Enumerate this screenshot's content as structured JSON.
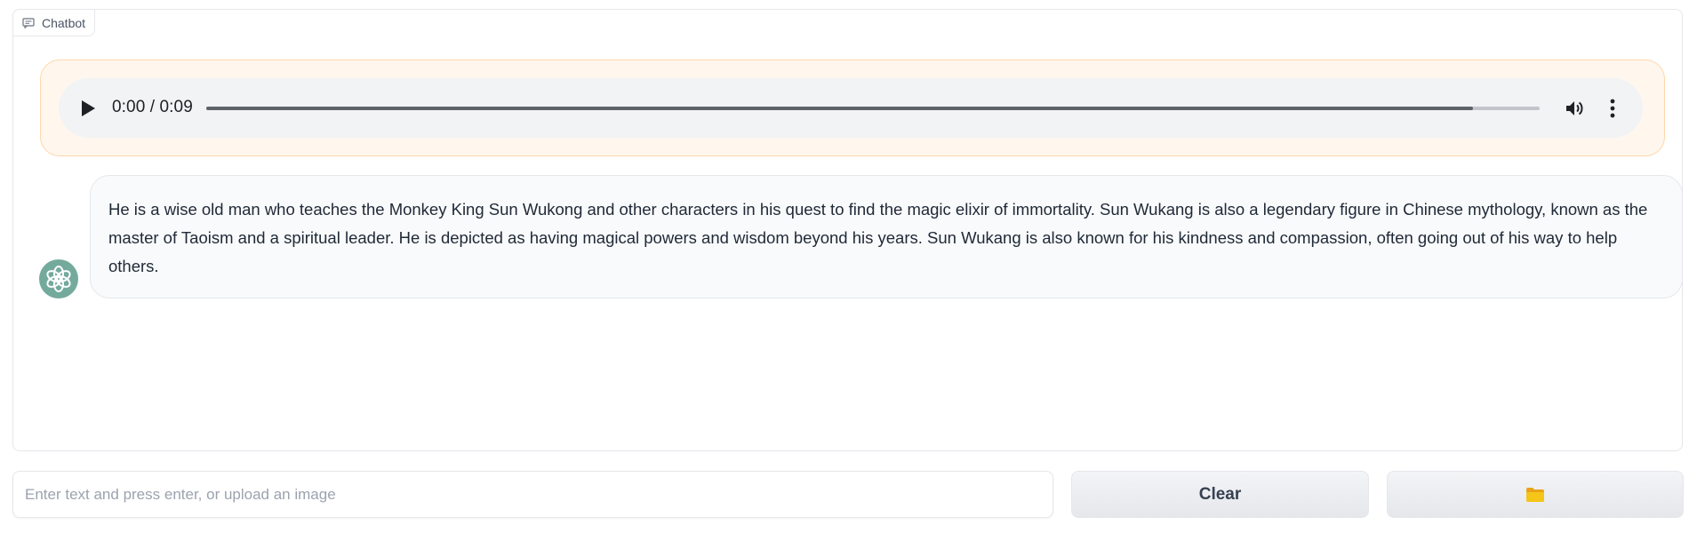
{
  "panel": {
    "label": "Chatbot"
  },
  "user_message": {
    "audio": {
      "time_display": "0:00 / 0:09",
      "progress": 0.95
    }
  },
  "bot_message": {
    "avatar_icon": "openai-logo-icon",
    "text": "He is a wise old man who teaches the Monkey King Sun Wukong and other characters in his quest to find the magic elixir of immortality. Sun Wukang is also a legendary figure in Chinese mythology, known as the master of Taoism and a spiritual leader. He is depicted as having magical powers and wisdom beyond his years. Sun Wukang is also known for his kindness and compassion, often going out of his way to help others."
  },
  "input": {
    "placeholder": "Enter text and press enter, or upload an image",
    "value": ""
  },
  "buttons": {
    "clear_label": "Clear",
    "upload_icon": "folder-icon"
  },
  "colors": {
    "user_bubble_bg": "#fff7ed",
    "user_bubble_border": "#fed7aa",
    "bot_bubble_bg": "#f9fafb",
    "avatar_bg": "#74aa9c",
    "folder": "#f5c518"
  }
}
